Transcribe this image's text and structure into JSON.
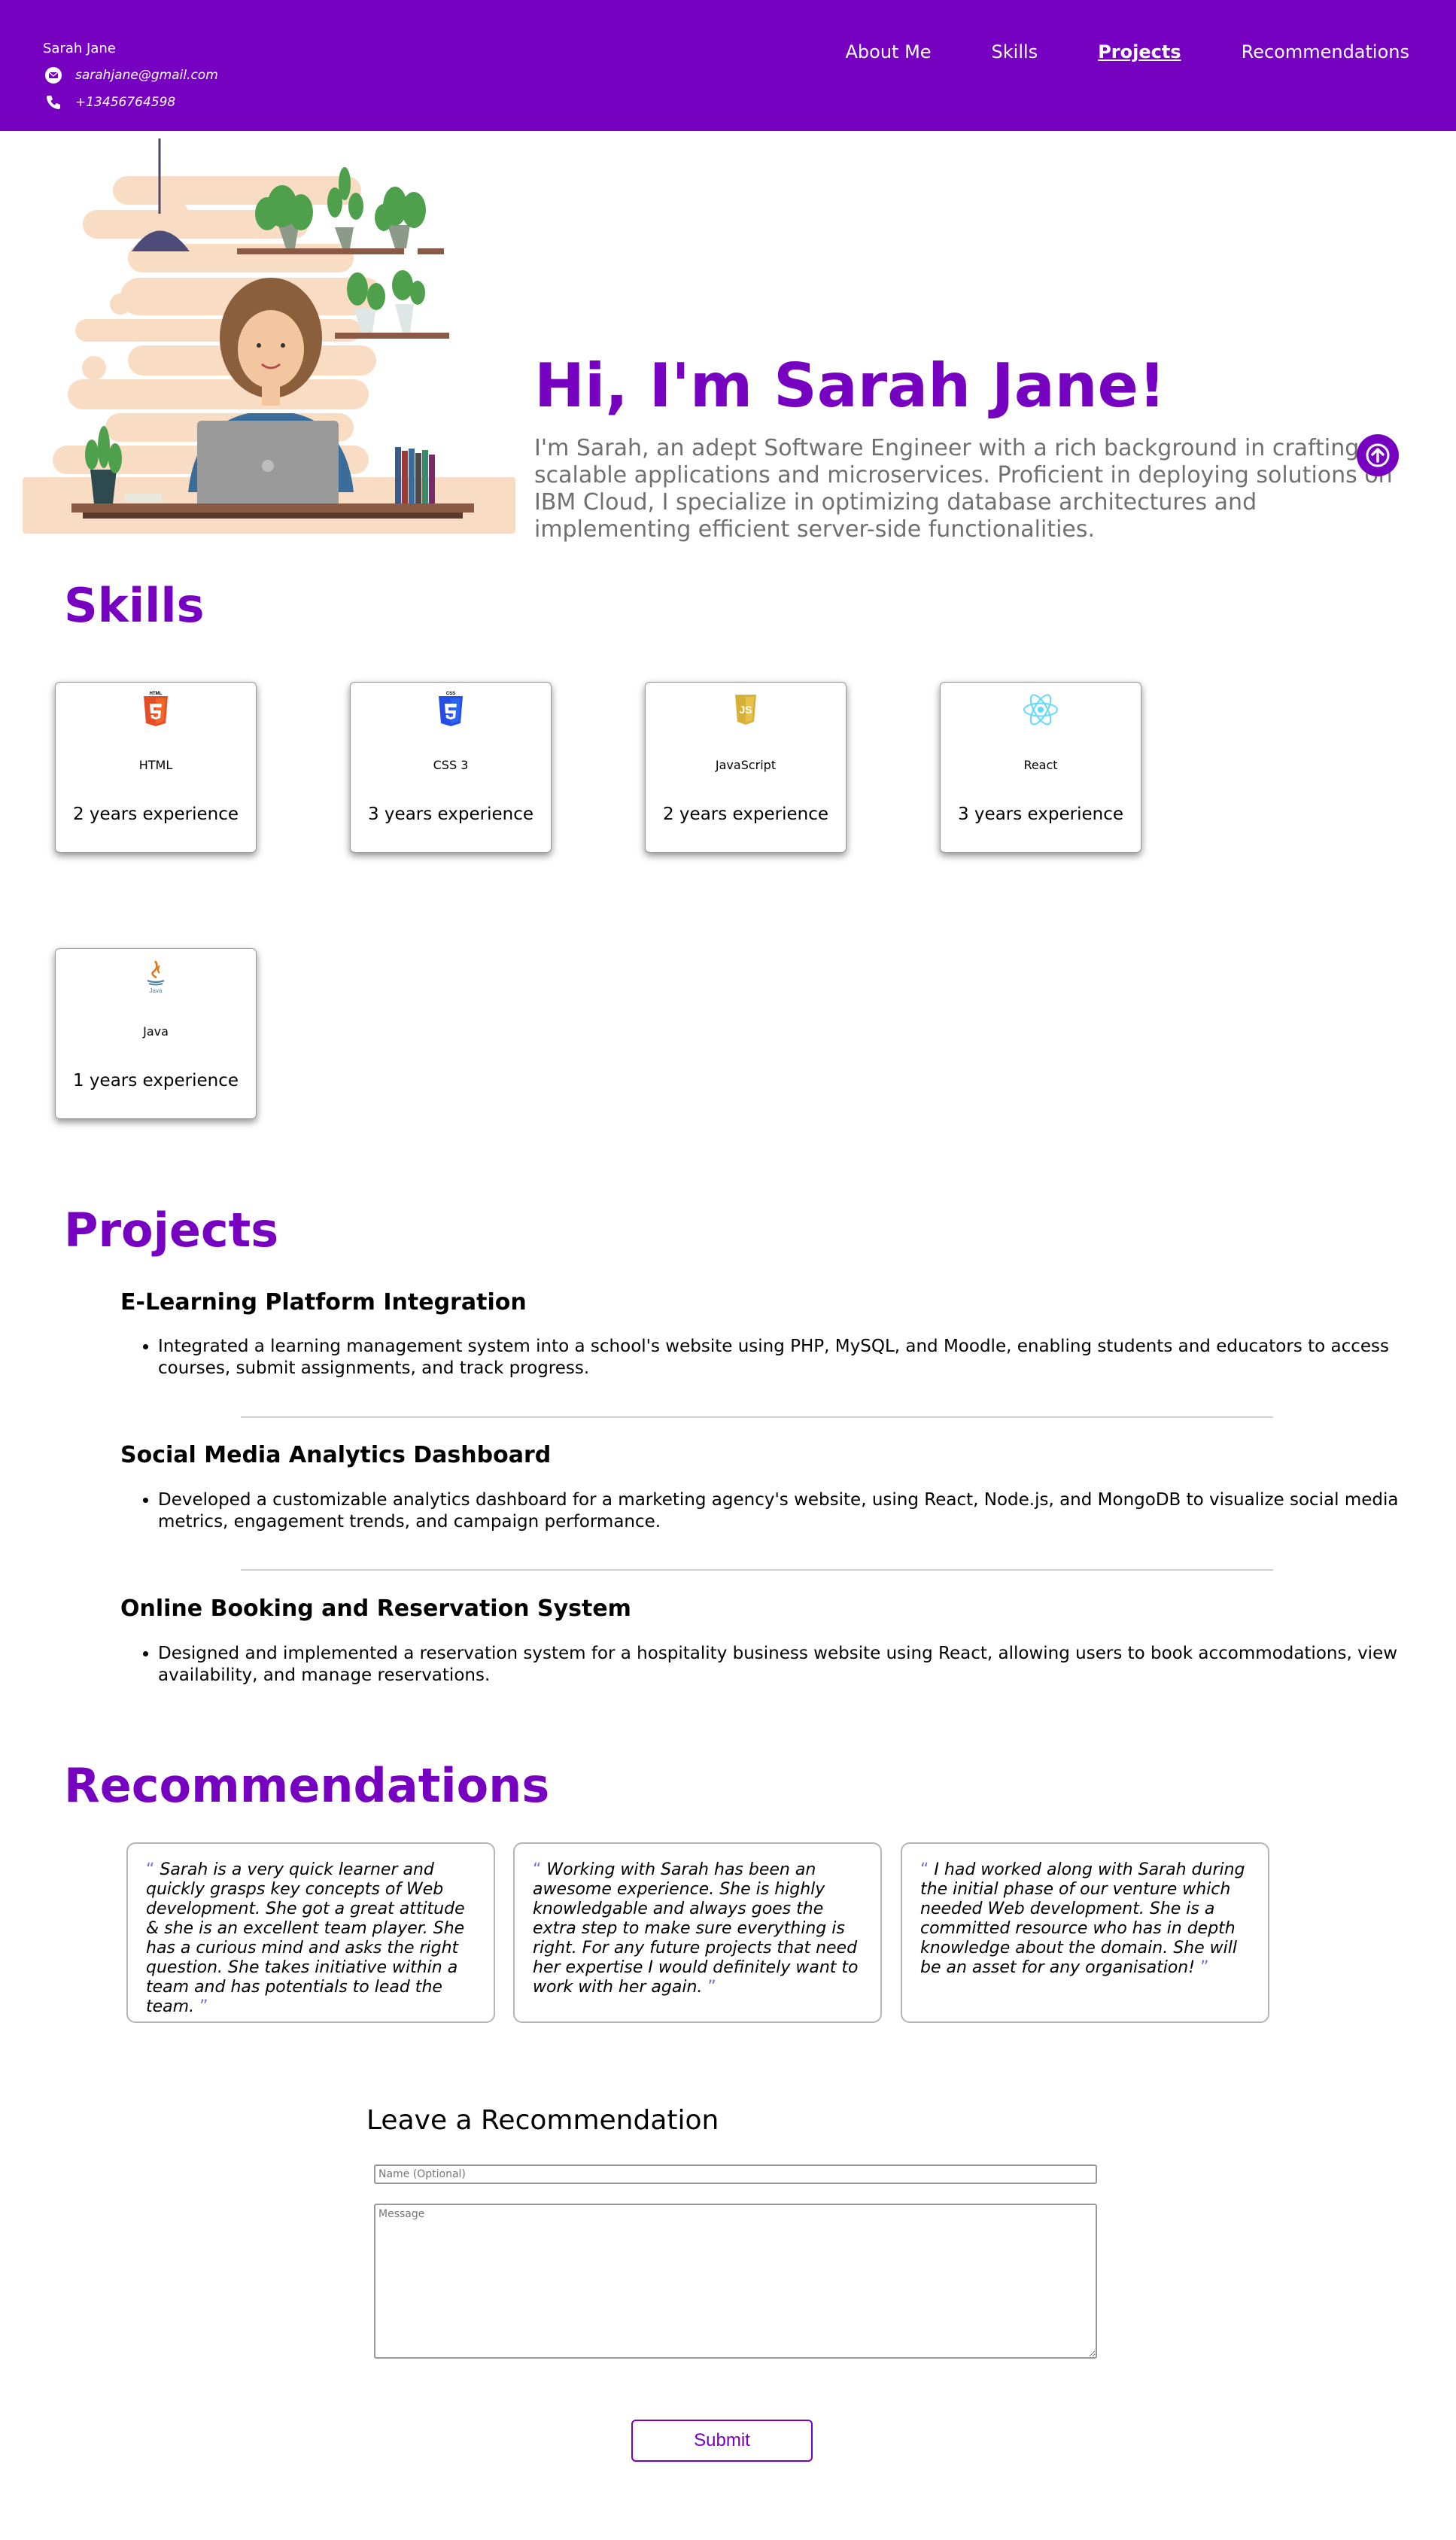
{
  "header": {
    "name": "Sarah Jane",
    "email": "sarahjane@gmail.com",
    "phone": "+13456764598",
    "nav": [
      {
        "label": "About Me",
        "active": false
      },
      {
        "label": "Skills",
        "active": false
      },
      {
        "label": "Projects",
        "active": true
      },
      {
        "label": "Recommendations",
        "active": false
      }
    ],
    "bg_color": "#7601c0"
  },
  "hero": {
    "title": "Hi, I'm Sarah Jane!",
    "text": "I'm Sarah, an adept Software Engineer with a rich background in crafting scalable applications and microservices. Proficient in deploying solutions on IBM Cloud, I specialize in optimizing database architectures and implementing efficient server-side functionalities."
  },
  "skills": {
    "title": "Skills",
    "items": [
      {
        "name": "HTML",
        "experience": "2 years experience",
        "icon": "html5-icon"
      },
      {
        "name": "CSS 3",
        "experience": "3 years experience",
        "icon": "css3-icon"
      },
      {
        "name": "JavaScript",
        "experience": "2 years experience",
        "icon": "javascript-icon"
      },
      {
        "name": "React",
        "experience": "3 years experience",
        "icon": "react-icon"
      },
      {
        "name": "Java",
        "experience": "1 years experience",
        "icon": "java-icon"
      }
    ]
  },
  "projects": {
    "title": "Projects",
    "items": [
      {
        "title": "E-Learning Platform Integration",
        "desc": "Integrated a learning management system into a school's website using PHP, MySQL, and Moodle, enabling students and educators to access courses, submit assignments, and track progress."
      },
      {
        "title": "Social Media Analytics Dashboard",
        "desc": "Developed a customizable analytics dashboard for a marketing agency's website, using React, Node.js, and MongoDB to visualize social media metrics, engagement trends, and campaign performance."
      },
      {
        "title": "Online Booking and Reservation System",
        "desc": "Designed and implemented a reservation system for a hospitality business website using React, allowing users to book accommodations, view availability, and manage reservations."
      }
    ]
  },
  "recommendations": {
    "title": "Recommendations",
    "open_quote": "“",
    "close_quote": "”",
    "items": [
      "Sarah is a very quick learner and quickly grasps key concepts of Web development. She got a great attitude & she is an excellent team player. She has a curious mind and asks the right question. She takes initiative within a team and has potentials to lead the team.",
      "Working with Sarah has been an awesome experience. She is highly knowledgable and always goes the extra step to make sure everything is right. For any future projects that need her expertise I would definitely want to work with her again.",
      "I had worked along with Sarah during the initial phase of our venture which needed Web development. She is a committed resource who has in depth knowledge about the domain. She will be an asset for any organisation!"
    ]
  },
  "form": {
    "title": "Leave a Recommendation",
    "name_placeholder": "Name (Optional)",
    "message_placeholder": "Message",
    "submit_label": "Submit"
  }
}
